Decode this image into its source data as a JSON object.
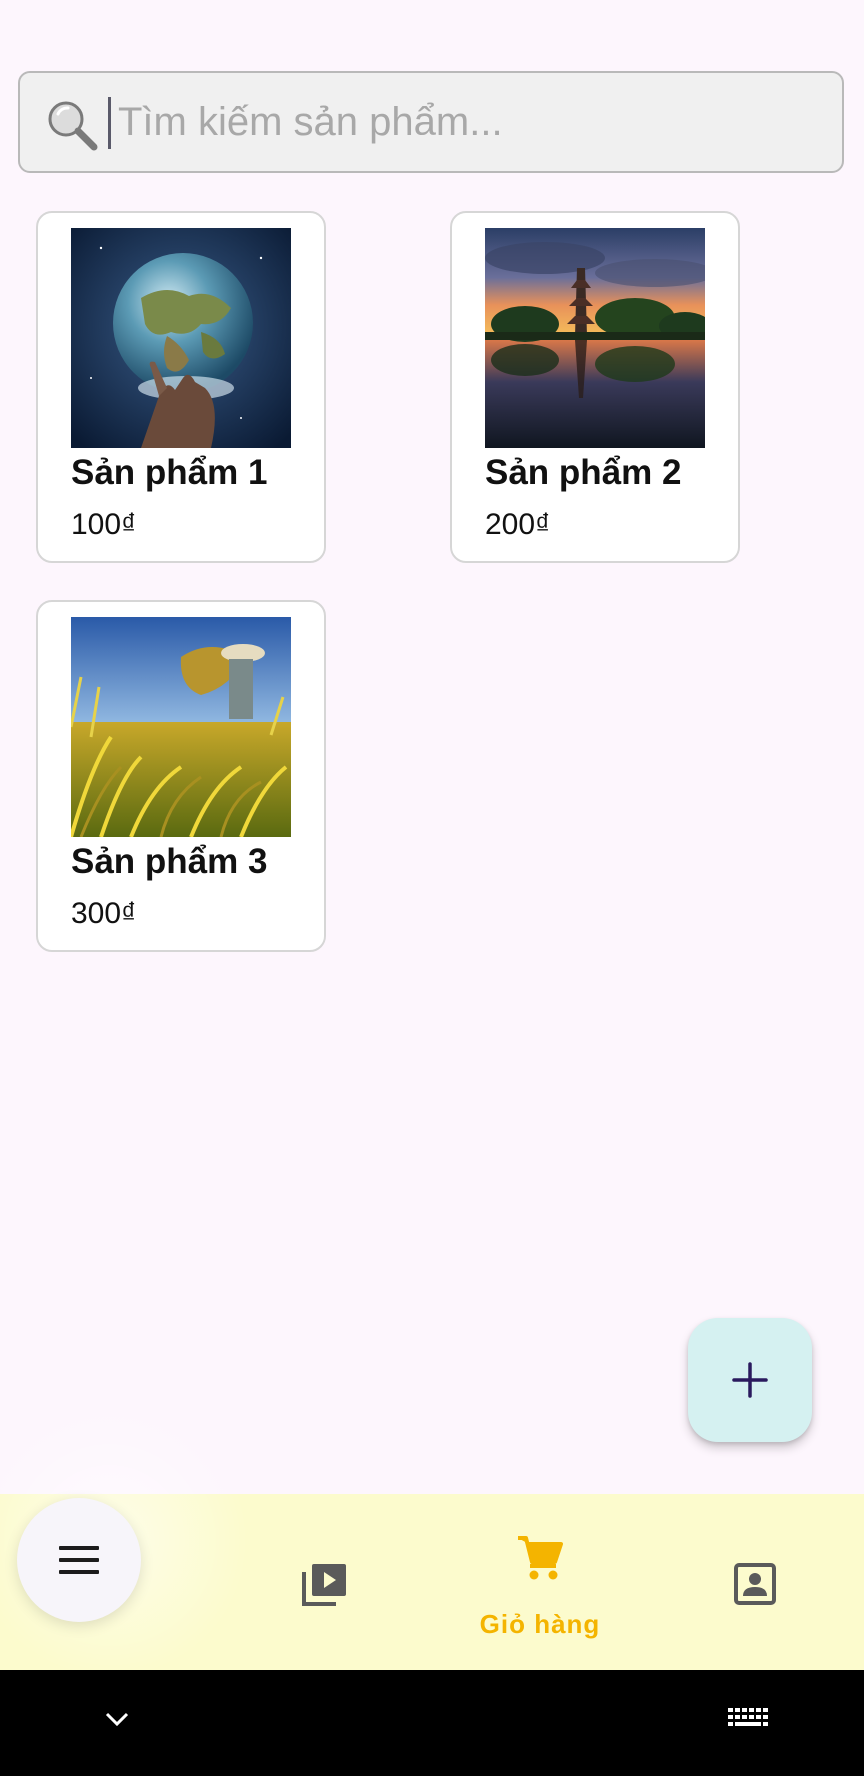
{
  "search": {
    "placeholder": "Tìm kiếm sản phẩm..."
  },
  "products": [
    {
      "name": "Sản phẩm 1",
      "price": "100₫",
      "image": "earth-in-hand-photo"
    },
    {
      "name": "Sản phẩm 2",
      "price": "200₫",
      "image": "pagoda-lake-sunset-photo"
    },
    {
      "name": "Sản phẩm 3",
      "price": "300₫",
      "image": "rice-harvest-farmer-photo"
    }
  ],
  "fab": {
    "icon": "plus-icon"
  },
  "bottom_nav": {
    "menu_icon": "hamburger-menu-icon",
    "items": [
      {
        "icon": "video-library-icon",
        "label": ""
      },
      {
        "icon": "shopping-cart-icon",
        "label": "Giỏ hàng",
        "active": true
      },
      {
        "icon": "contact-card-icon",
        "label": ""
      }
    ]
  },
  "system_bar": {
    "left_icon": "chevron-down-icon",
    "right_icon": "keyboard-icon"
  },
  "colors": {
    "background": "#fdf6fd",
    "nav_background": "#fcfbcd",
    "active_accent": "#f4b400",
    "fab_background": "#d5f1f1",
    "fab_icon": "#2a1a5e"
  }
}
